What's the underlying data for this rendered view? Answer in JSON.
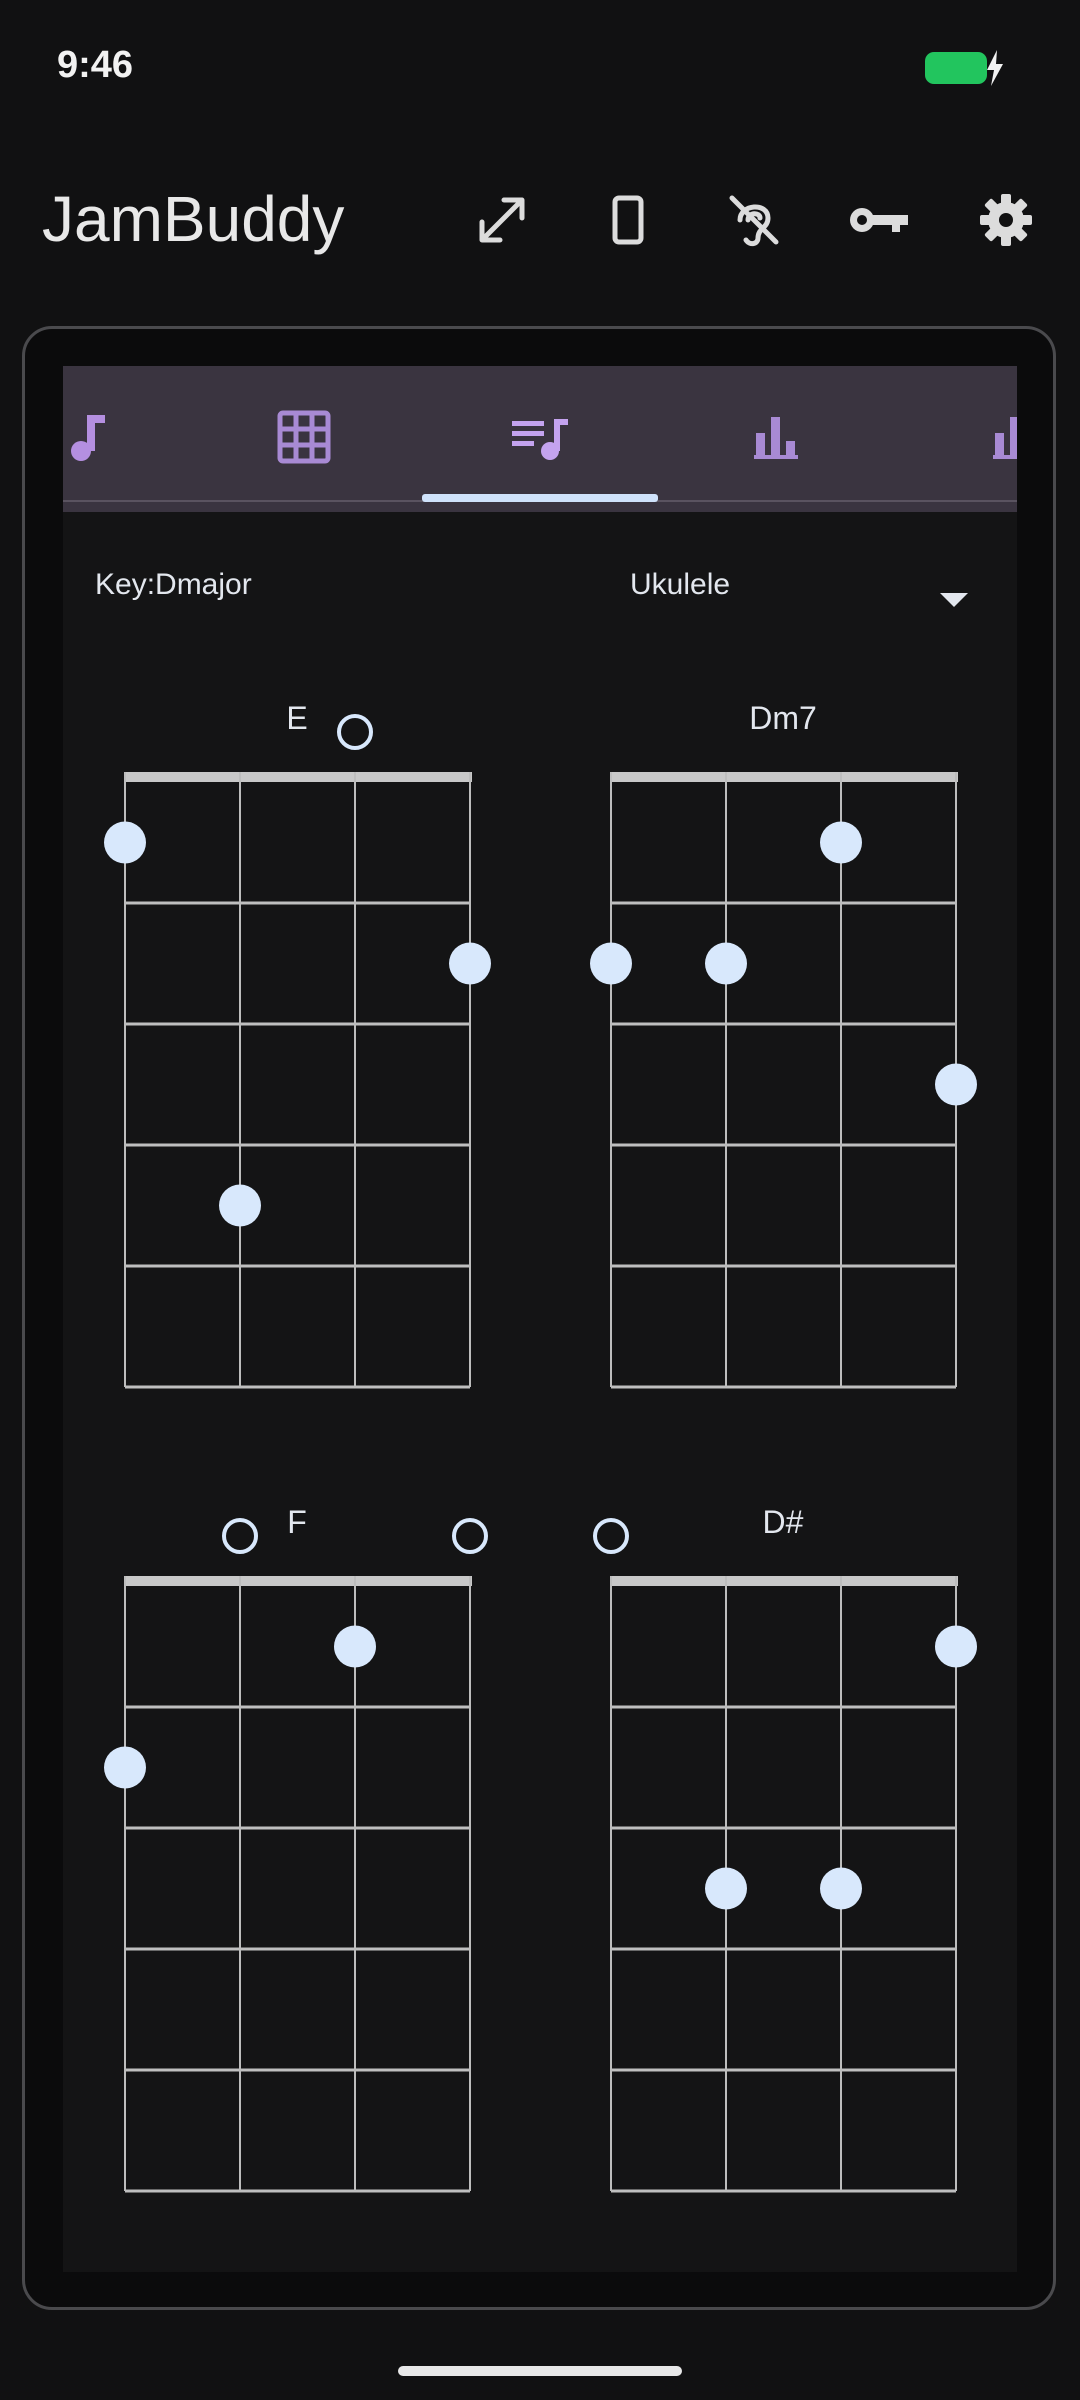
{
  "status_bar": {
    "time": "9:46",
    "icons": [
      "battery-charging-icon"
    ]
  },
  "app_bar": {
    "title": "JamBuddy",
    "actions": [
      "fullscreen-icon",
      "rotate-device-icon",
      "hearing-disabled-icon",
      "key-icon",
      "settings-icon"
    ]
  },
  "tabs": {
    "items": [
      "music-note-icon",
      "grid-icon",
      "playlist-music-icon",
      "bar-chart-icon",
      "bar-chart-icon"
    ],
    "selected_index": 2
  },
  "controls": {
    "key_label": "Key:Dmajor",
    "instrument": "Ukulele"
  },
  "chords": [
    {
      "name": "E",
      "fingers": [
        [
          0,
          1
        ],
        [
          3,
          2
        ],
        [
          1,
          4
        ]
      ],
      "open": [
        2
      ]
    },
    {
      "name": "Dm7",
      "fingers": [
        [
          2,
          1
        ],
        [
          0,
          2
        ],
        [
          1,
          2
        ],
        [
          3,
          3
        ]
      ],
      "open": []
    },
    {
      "name": "F",
      "fingers": [
        [
          2,
          1
        ],
        [
          0,
          2
        ]
      ],
      "open": [
        1,
        3
      ]
    },
    {
      "name": "D#",
      "fingers": [
        [
          3,
          1
        ],
        [
          1,
          3
        ],
        [
          2,
          3
        ]
      ],
      "open": [
        0
      ]
    }
  ],
  "colors": {
    "accent": "#c4a3ef",
    "dot": "#d8e8fc",
    "tab_bg": "#3a3440",
    "indicator": "#cfe2fb"
  }
}
